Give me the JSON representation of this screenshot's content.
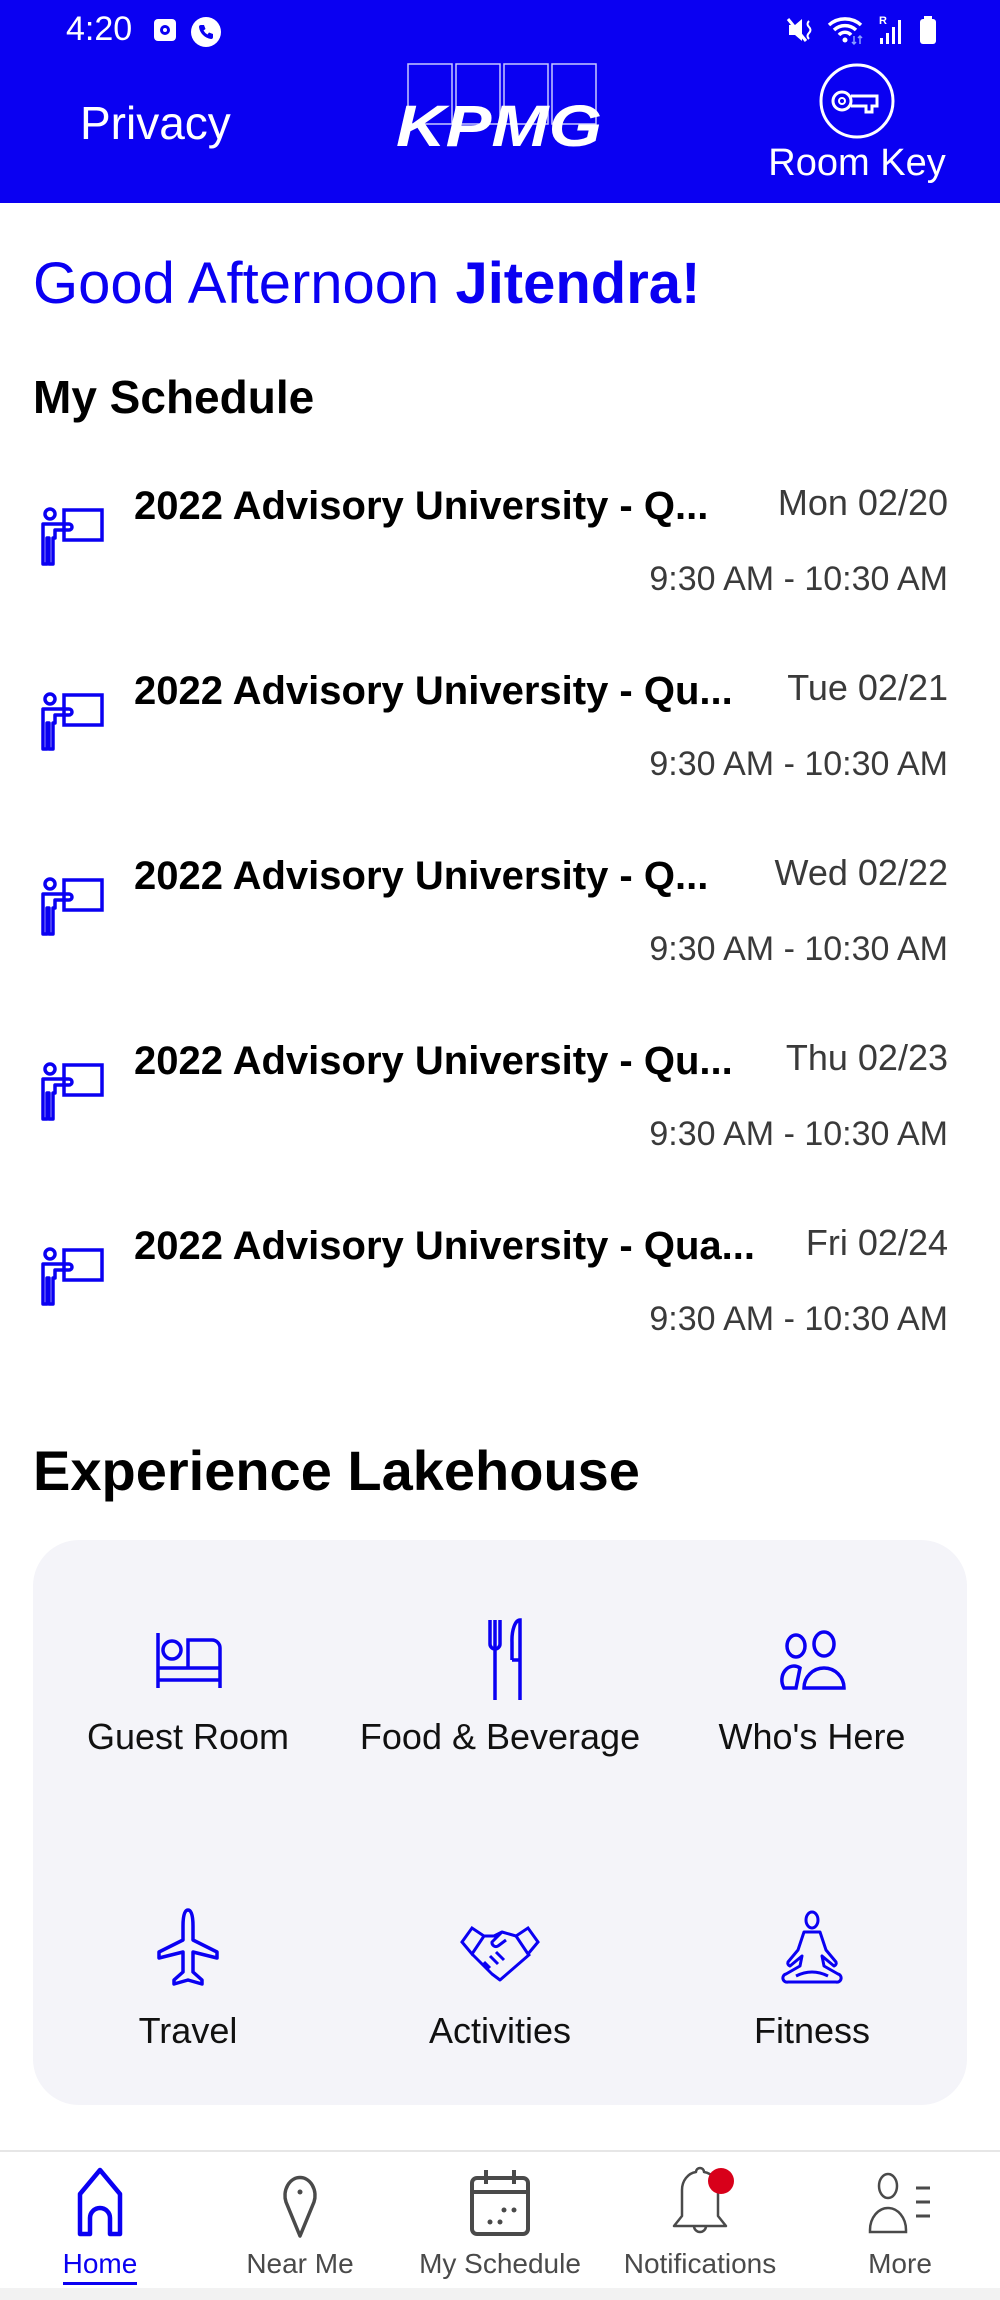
{
  "status_bar": {
    "time": "4:20",
    "left_icons": [
      "screen-recorder-icon",
      "phone-call-icon"
    ],
    "right_icons": [
      "mute-vibrate-icon",
      "wifi-icon",
      "signal-roaming-icon",
      "battery-icon"
    ]
  },
  "header": {
    "privacy_label": "Privacy",
    "logo_text": "KPMG",
    "room_key_label": "Room Key",
    "background_color": "#0A00F2"
  },
  "greeting": {
    "salutation": "Good Afternoon",
    "name": "Jitendra!"
  },
  "schedule": {
    "title": "My Schedule",
    "items": [
      {
        "title": "2022 Advisory University - Q...",
        "date": "Mon 02/20",
        "time": "9:30 AM - 10:30 AM",
        "icon": "presenter-icon"
      },
      {
        "title": "2022 Advisory University - Qu...",
        "date": "Tue 02/21",
        "time": "9:30 AM - 10:30 AM",
        "icon": "presenter-icon"
      },
      {
        "title": "2022 Advisory University - Q...",
        "date": "Wed 02/22",
        "time": "9:30 AM - 10:30 AM",
        "icon": "presenter-icon"
      },
      {
        "title": "2022 Advisory University - Qu...",
        "date": "Thu 02/23",
        "time": "9:30 AM - 10:30 AM",
        "icon": "presenter-icon"
      },
      {
        "title": "2022 Advisory University - Qua...",
        "date": "Fri 02/24",
        "time": "9:30 AM - 10:30 AM",
        "icon": "presenter-icon"
      }
    ]
  },
  "experience": {
    "title": "Experience Lakehouse",
    "tiles": [
      {
        "label": "Guest Room",
        "icon": "bed-icon"
      },
      {
        "label": "Food & Beverage",
        "icon": "fork-knife-icon"
      },
      {
        "label": "Who's Here",
        "icon": "people-icon"
      },
      {
        "label": "Travel",
        "icon": "airplane-icon"
      },
      {
        "label": "Activities",
        "icon": "handshake-icon"
      },
      {
        "label": "Fitness",
        "icon": "yoga-icon"
      }
    ]
  },
  "bottom_nav": {
    "active": "Home",
    "items": [
      {
        "label": "Home",
        "icon": "home-icon"
      },
      {
        "label": "Near Me",
        "icon": "location-pin-icon"
      },
      {
        "label": "My Schedule",
        "icon": "calendar-icon"
      },
      {
        "label": "Notifications",
        "icon": "bell-icon",
        "has_badge": true
      },
      {
        "label": "More",
        "icon": "profile-menu-icon"
      }
    ]
  },
  "colors": {
    "accent": "#0A00F2",
    "card_background": "#F4F4F9",
    "badge": "#D8001A",
    "inactive_nav": "#4a4a4a"
  }
}
